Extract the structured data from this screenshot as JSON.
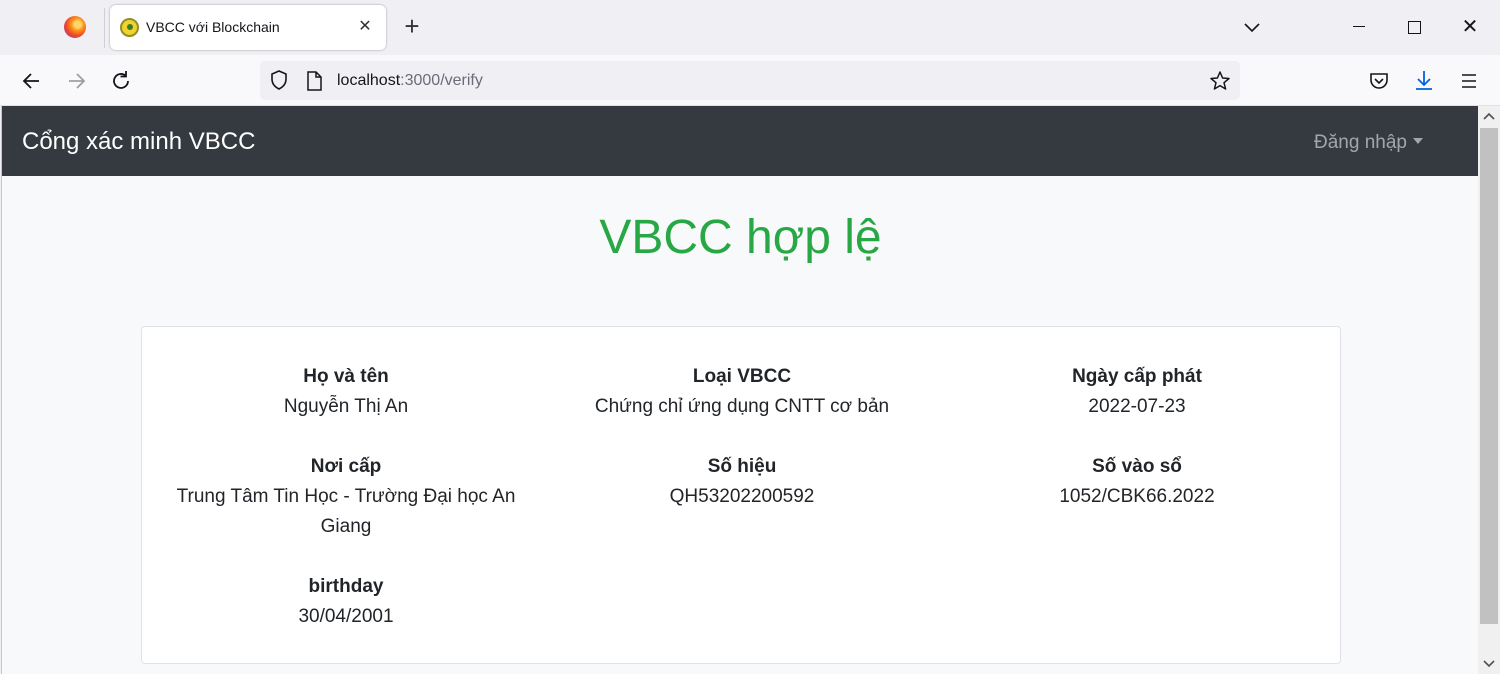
{
  "browser": {
    "tab_title": "VBCC với Blockchain",
    "tab_close": "✕",
    "new_tab": "+",
    "window_close": "✕",
    "url_host": "localhost",
    "url_path": ":3000/verify"
  },
  "site": {
    "brand": "Cổng xác minh VBCC",
    "login_label": "Đăng nhập"
  },
  "main": {
    "status_title": "VBCC hợp lệ",
    "status_color": "#28a745"
  },
  "certificate": {
    "fields": [
      {
        "label": "Họ và tên",
        "value": "Nguyễn Thị An"
      },
      {
        "label": "Loại VBCC",
        "value": "Chứng chỉ ứng dụng CNTT cơ bản"
      },
      {
        "label": "Ngày cấp phát",
        "value": "2022-07-23"
      },
      {
        "label": "Nơi cấp",
        "value": "Trung Tâm Tin Học - Trường Đại học An Giang"
      },
      {
        "label": "Số hiệu",
        "value": "QH53202200592"
      },
      {
        "label": "Số vào sổ",
        "value": "1052/CBK66.2022"
      },
      {
        "label": "birthday",
        "value": "30/04/2001"
      }
    ]
  },
  "icons": {
    "browser_logo": "firefox-logo",
    "back": "arrow-left-icon",
    "forward": "arrow-right-icon",
    "reload": "reload-icon",
    "shield": "shield-icon",
    "page": "page-icon",
    "bookmark": "star-icon",
    "pocket": "pocket-icon",
    "downloads": "download-icon",
    "menu": "hamburger-menu-icon"
  }
}
